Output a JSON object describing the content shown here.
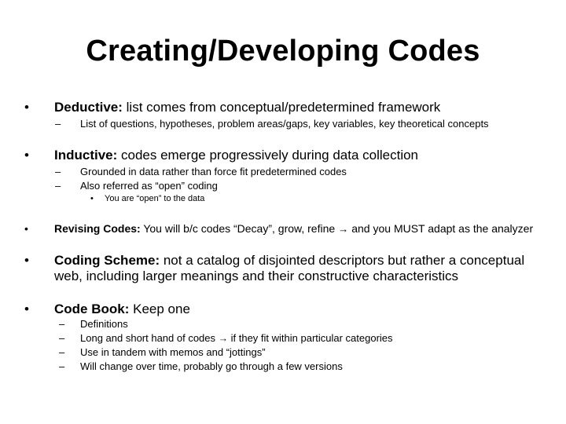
{
  "title": "Creating/Developing Codes",
  "bullet_glyph": "•",
  "dash_glyph": "–",
  "arrow_glyph": "→",
  "items": [
    {
      "label": "Deductive:",
      "text": " list comes from conceptual/predetermined framework",
      "sub": [
        "List of questions, hypotheses, problem areas/gaps, key variables, key theoretical concepts"
      ]
    },
    {
      "label": "Inductive:",
      "text": " codes emerge progressively during data collection",
      "sub": [
        "Grounded in data rather than force fit predetermined codes",
        "Also referred as “open” coding"
      ],
      "subsub": [
        "You are “open” to the data"
      ]
    },
    {
      "label": "Revising Codes:",
      "text_before": " You will b/c codes “Decay”, grow, refine ",
      "text_after": " and you MUST adapt as the analyzer"
    },
    {
      "label": "Coding Scheme:",
      "text": " not a catalog of disjointed descriptors but rather a conceptual web, including larger meanings and their constructive characteristics"
    },
    {
      "label": "Code Book:",
      "text": " Keep one",
      "sub": [
        "Definitions",
        "Long and short hand of codes",
        "Use in tandem with memos and “jottings”",
        "Will change over time, probably go through a few versions"
      ],
      "sub1_after_arrow": " if they fit within particular categories"
    }
  ]
}
